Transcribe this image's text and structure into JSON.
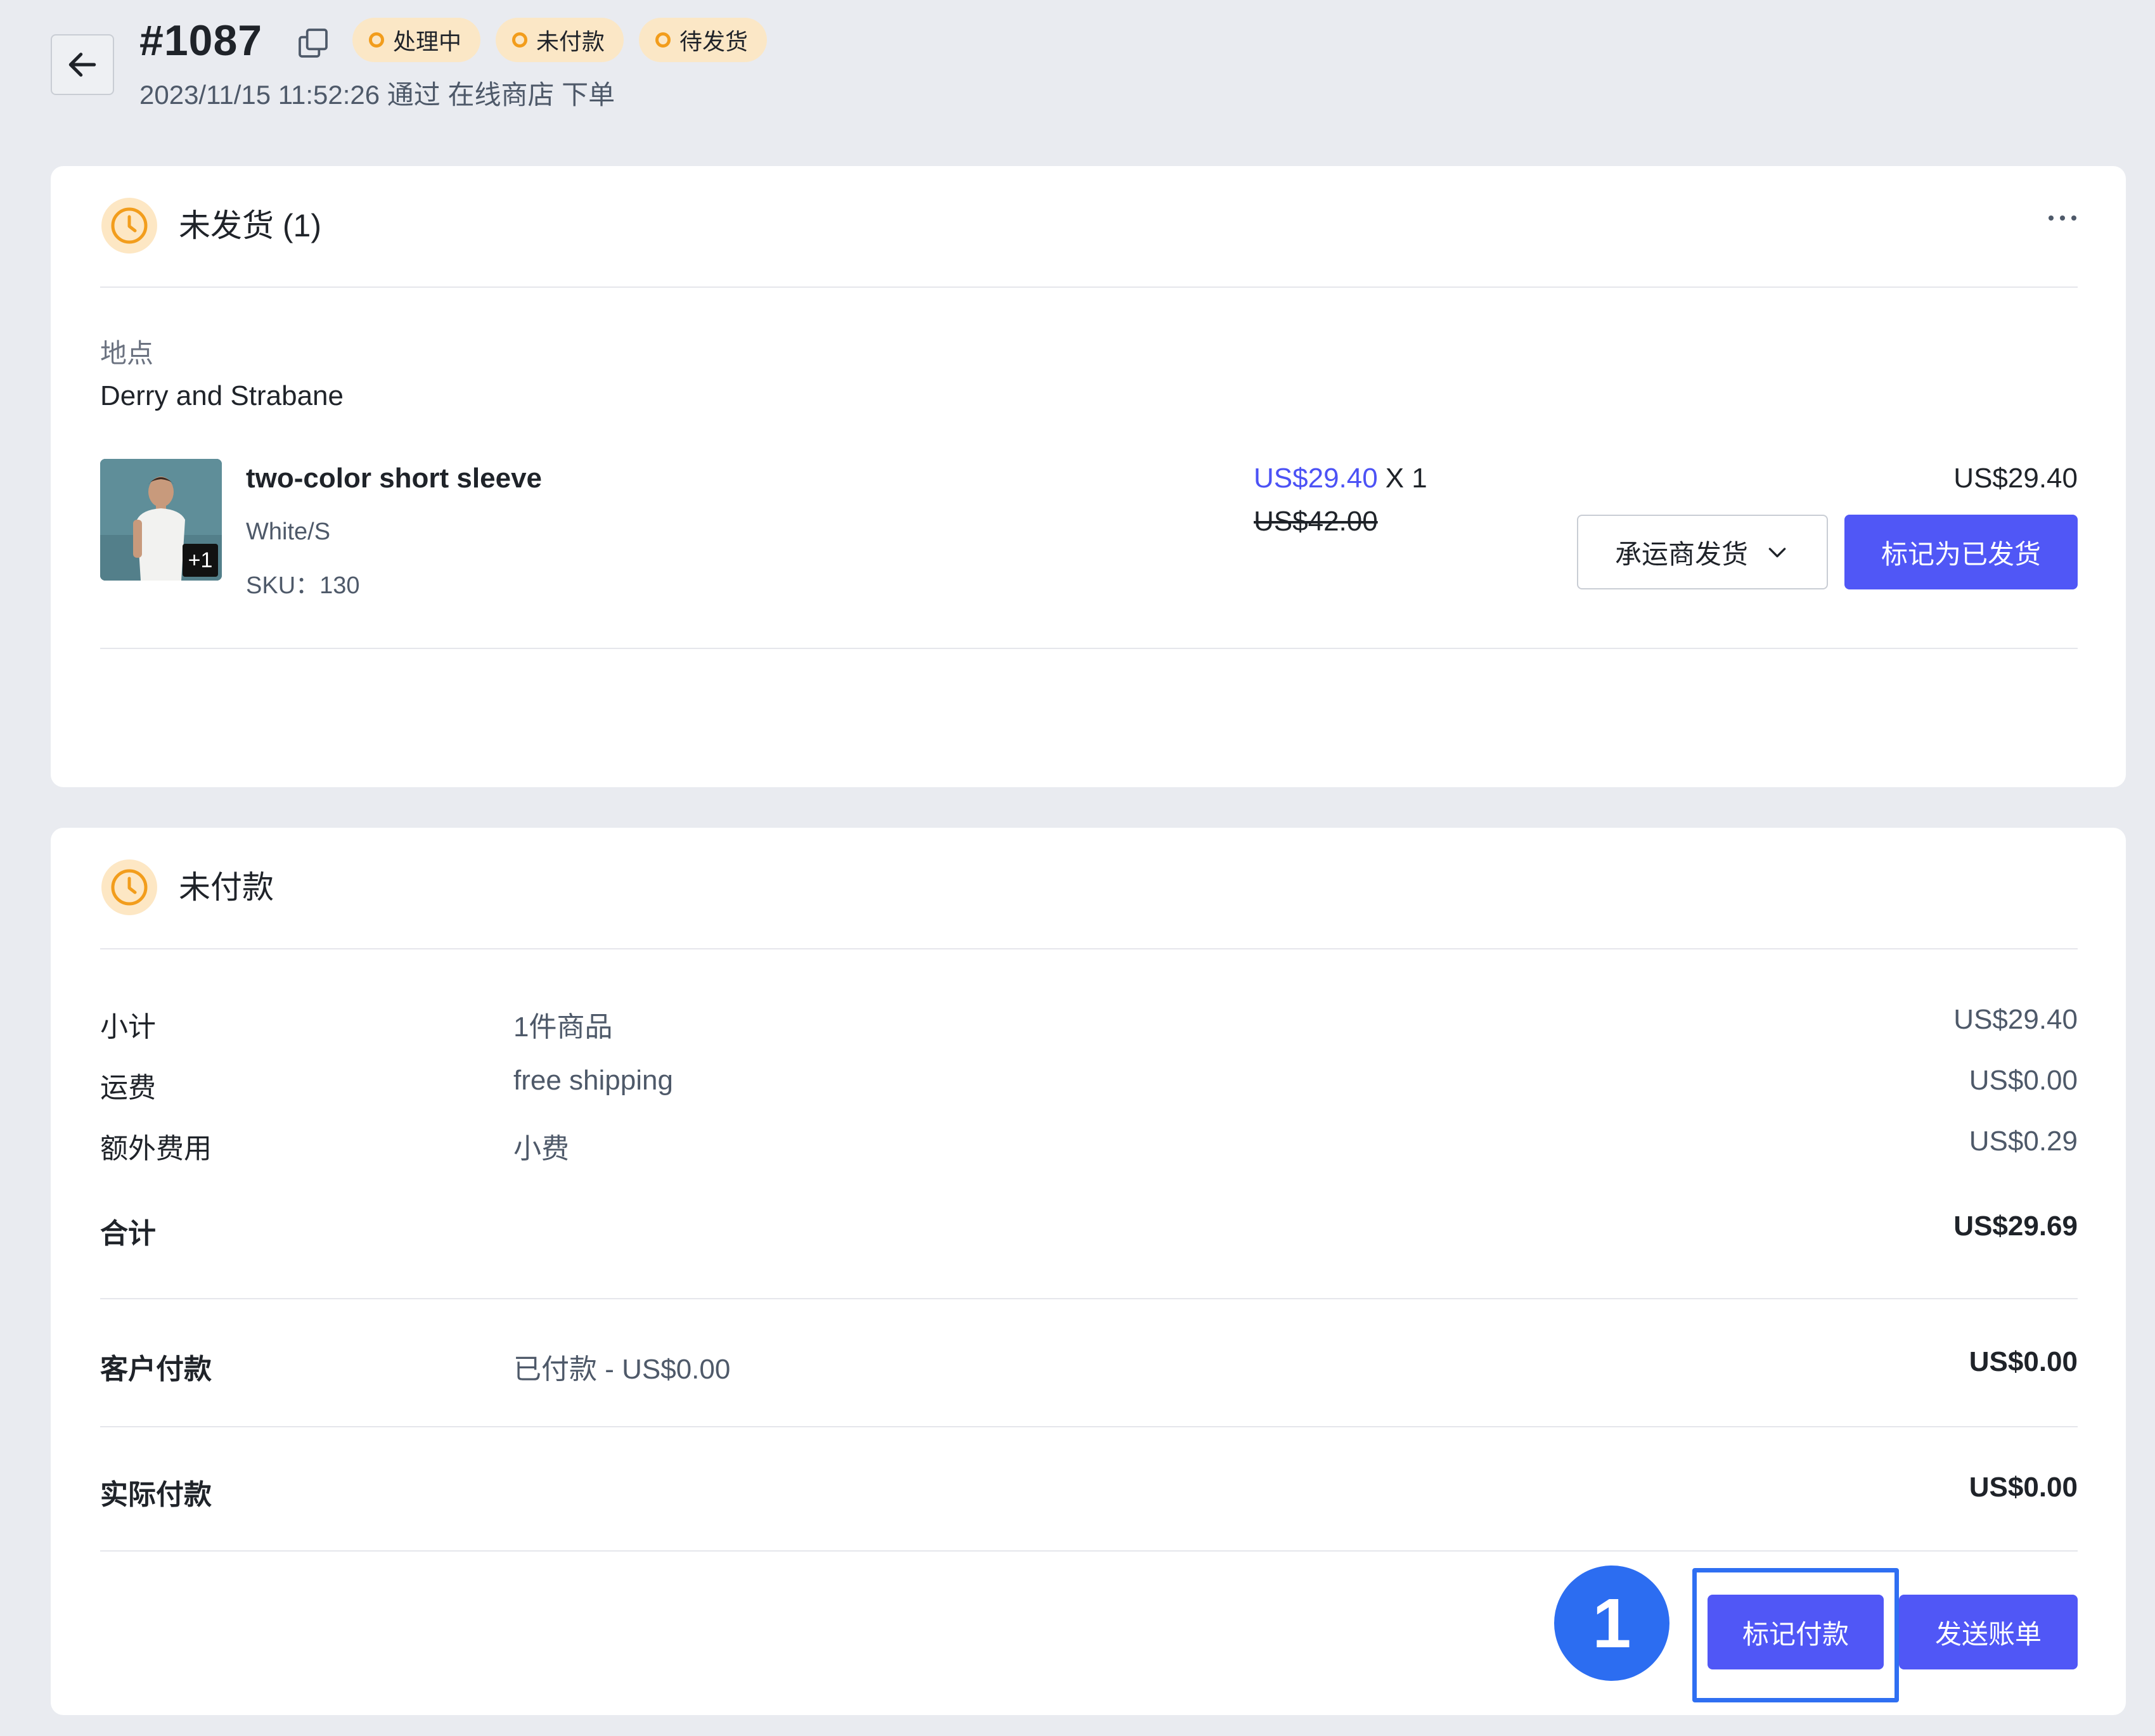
{
  "header": {
    "order_number": "#1087",
    "badges": [
      "处理中",
      "未付款",
      "待发货"
    ],
    "meta": "2023/11/15 11:52:26 通过 在线商店 下单"
  },
  "fulfillment": {
    "title": "未发货 (1)",
    "location_label": "地点",
    "location_value": "Derry and Strabane",
    "item": {
      "name": "two-color short sleeve",
      "variant": "White/S",
      "sku": "SKU：130",
      "thumb_badge": "+1",
      "sale_price": "US$29.40",
      "quantity": "X 1",
      "original_price": "US$42.00",
      "line_total": "US$29.40"
    },
    "carrier_button": "承运商发货",
    "mark_shipped_button": "标记为已发货"
  },
  "payment": {
    "title": "未付款",
    "rows": [
      {
        "label": "小计",
        "detail": "1件商品",
        "amount": "US$29.40"
      },
      {
        "label": "运费",
        "detail": "free shipping",
        "amount": "US$0.00"
      },
      {
        "label": "额外费用",
        "detail": "小费",
        "amount": "US$0.29"
      }
    ],
    "total": {
      "label": "合计",
      "amount": "US$29.69"
    },
    "customer_paid": {
      "label": "客户付款",
      "detail": "已付款 - US$0.00",
      "amount": "US$0.00"
    },
    "actual_paid": {
      "label": "实际付款",
      "amount": "US$0.00"
    },
    "mark_paid_button": "标记付款",
    "send_bill_button": "发送账单"
  },
  "annotation": {
    "step": "1"
  },
  "colors": {
    "accent": "#5057f6",
    "badge_bg": "#fbe7c6",
    "badge_dot": "#f29d1c",
    "annotation": "#2c6df1"
  }
}
